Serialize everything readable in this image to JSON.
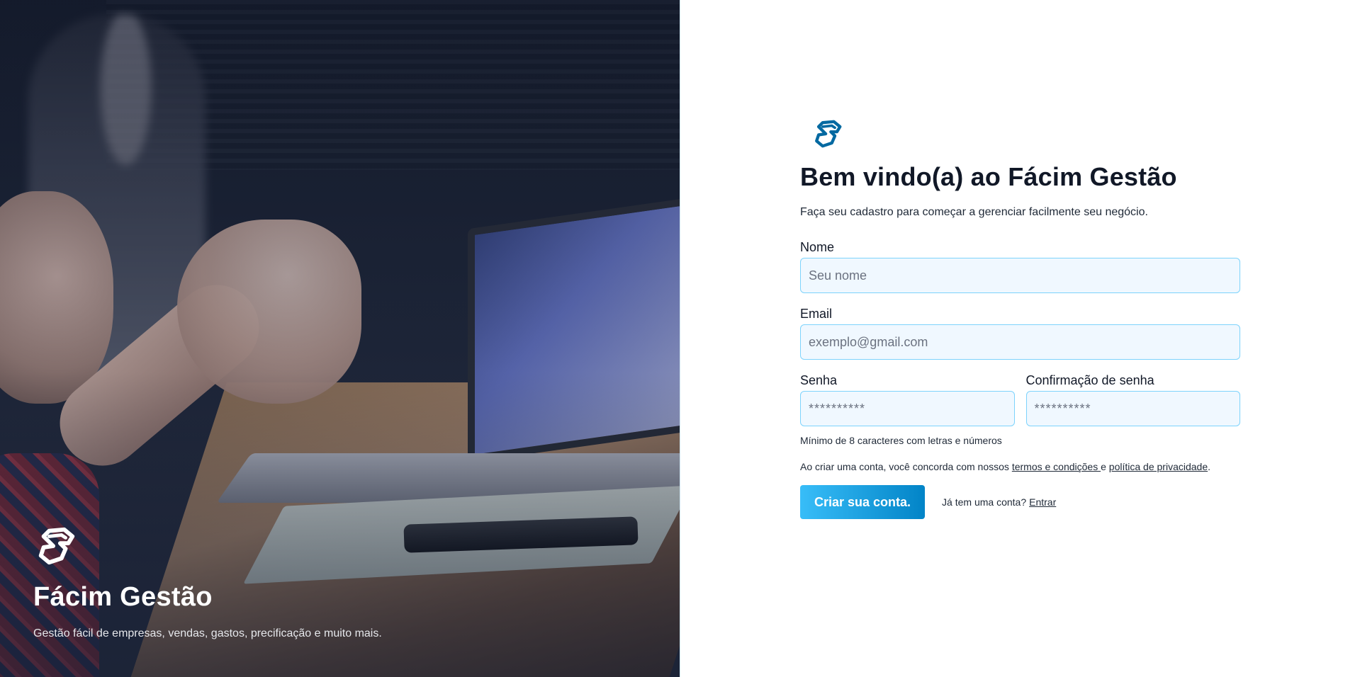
{
  "hero": {
    "brand": "Fácim Gestão",
    "tagline": "Gestão fácil de empresas, vendas, gastos, precificação e muito mais.",
    "logo_icon": "facim-logo-icon"
  },
  "form": {
    "logo_icon": "facim-logo-icon",
    "title": "Bem vindo(a) ao Fácim Gestão",
    "subtitle": "Faça seu cadastro para começar a gerenciar facilmente seu negócio.",
    "name": {
      "label": "Nome",
      "placeholder": "Seu nome",
      "value": ""
    },
    "email": {
      "label": "Email",
      "placeholder": "exemplo@gmail.com",
      "value": ""
    },
    "password": {
      "label": "Senha",
      "placeholder": "**********",
      "value": ""
    },
    "password_confirm": {
      "label": "Confirmação de senha",
      "placeholder": "**********",
      "value": ""
    },
    "password_hint": "Mínimo de 8 caracteres com letras e números",
    "terms": {
      "prefix": "Ao criar uma conta, você concorda com nossos ",
      "terms_link": "termos e condições ",
      "middle": "e ",
      "privacy_link": "política de privacidade",
      "suffix": "."
    },
    "submit_label": "Criar sua conta.",
    "login_prompt": "Já tem uma conta?",
    "login_link": "Entrar"
  },
  "colors": {
    "accent": "#0284c7",
    "accent_light": "#38bdf8",
    "input_bg": "#f0f8ff",
    "input_border": "#7dd3fc",
    "text": "#111827"
  }
}
